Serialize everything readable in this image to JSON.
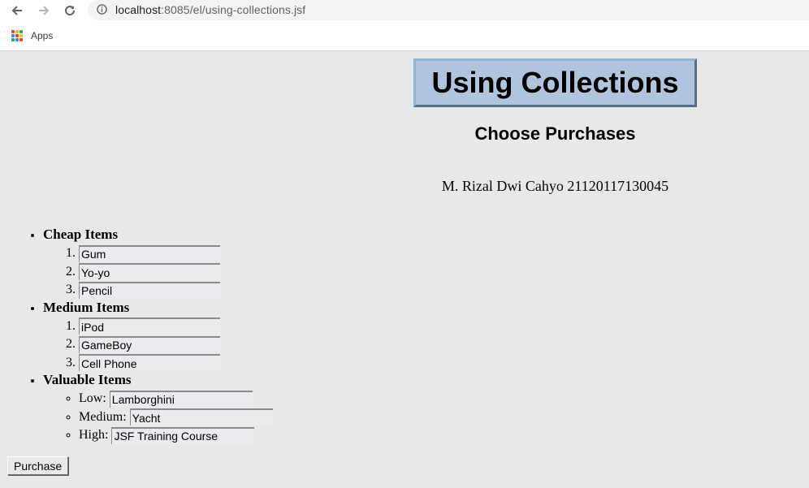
{
  "browser": {
    "url_host": "localhost",
    "url_rest": ":8085/el/using-collections.jsf",
    "bookmarks": {
      "apps_label": "Apps"
    },
    "apps_colors": [
      "#ea4335",
      "#fbbc05",
      "#34a853",
      "#4285f4",
      "#ea4335",
      "#fbbc05",
      "#34a853",
      "#4285f4",
      "#ea4335"
    ]
  },
  "page": {
    "title": "Using Collections",
    "subtitle": "Choose Purchases",
    "author": "M. Rizal Dwi Cahyo 21120117130045"
  },
  "categories": {
    "cheap": {
      "label": "Cheap Items",
      "items": [
        "Gum",
        "Yo-yo",
        "Pencil"
      ]
    },
    "medium": {
      "label": "Medium Items",
      "items": [
        "iPod",
        "GameBoy",
        "Cell Phone"
      ]
    },
    "valuable": {
      "label": "Valuable Items",
      "entries": [
        {
          "label": "Low:",
          "value": "Lamborghini"
        },
        {
          "label": "Medium:",
          "value": "Yacht"
        },
        {
          "label": "High:",
          "value": "JSF Training Course"
        }
      ]
    }
  },
  "purchase_button": "Purchase"
}
